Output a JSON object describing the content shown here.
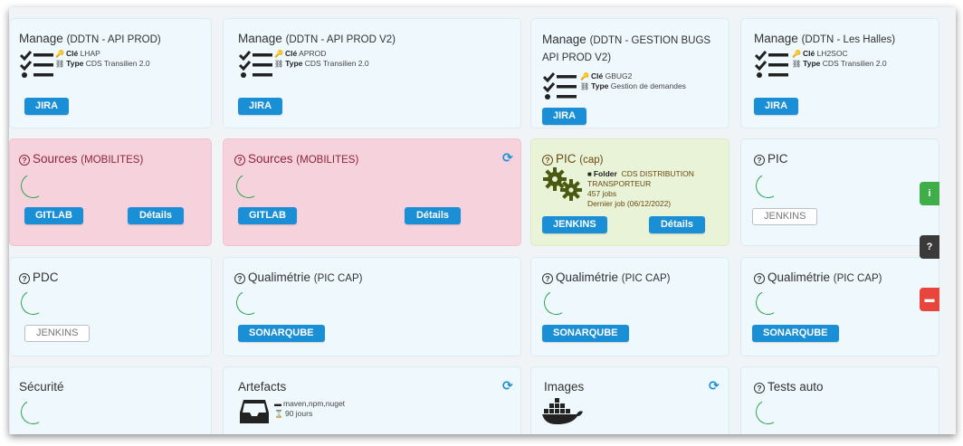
{
  "row1": [
    {
      "title": "Manage",
      "sub": "(DDTN - API PROD)",
      "key_label": "Clé",
      "key": "LHAP",
      "type_label": "Type",
      "type": "CDS Transilien 2.0",
      "button": "JIRA"
    },
    {
      "title": "Manage",
      "sub": "(DDTN - API PROD V2)",
      "key_label": "Clé",
      "key": "APROD",
      "type_label": "Type",
      "type": "CDS Transilien 2.0",
      "button": "JIRA"
    },
    {
      "title": "Manage",
      "sub": "(DDTN - GESTION BUGS API PROD V2)",
      "key_label": "Clé",
      "key": "GBUG2",
      "type_label": "Type",
      "type": "Gestion de demandes",
      "button": "JIRA"
    },
    {
      "title": "Manage",
      "sub": "(DDTN - Les Halles)",
      "key_label": "Clé",
      "key": "LH2SOC",
      "type_label": "Type",
      "type": "CDS Transilien 2.0",
      "button": "JIRA"
    }
  ],
  "row2": [
    {
      "title": "Sources",
      "sub": "(MOBILITES)",
      "button": "GITLAB",
      "details": "Détails"
    },
    {
      "title": "Sources",
      "sub": "(MOBILITES)",
      "button": "GITLAB",
      "details": "Détails"
    },
    {
      "title": "PIC",
      "sub": "(cap)",
      "folder_label": "Folder",
      "folder": "CDS DISTRIBUTION",
      "folder2": "TRANSPORTEUR",
      "jobs": "457  jobs",
      "last_job": "Dernier job (06/12/2022)",
      "button": "JENKINS",
      "details": "Détails"
    },
    {
      "title": "PIC",
      "button": "JENKINS"
    }
  ],
  "row3": [
    {
      "title": "PDC",
      "button": "JENKINS"
    },
    {
      "title": "Qualimétrie",
      "sub": "(PIC CAP)",
      "button": "SONARQUBE"
    },
    {
      "title": "Qualimétrie",
      "sub": "(PIC CAP)",
      "button": "SONARQUBE"
    },
    {
      "title": "Qualimétrie",
      "sub": "(PIC CAP)",
      "button": "SONARQUBE"
    }
  ],
  "row4": [
    {
      "title": "Sécurité"
    },
    {
      "title": "Artefacts",
      "formats": "maven,npm,nuget",
      "retention": "90 jours"
    },
    {
      "title": "Images"
    },
    {
      "title": "Tests auto"
    }
  ],
  "side_tabs": [
    {
      "icon": "info-icon",
      "color": "#3fae49"
    },
    {
      "icon": "help-icon",
      "color": "#3a3a3a"
    },
    {
      "icon": "comment-icon",
      "color": "#e8463c"
    }
  ],
  "colors": {
    "primary": "#1a8fd6",
    "spinner": "#2aa34e",
    "pink_card": "#f5d2dc",
    "green_card": "#e8f3d7",
    "blue_card": "#eef8fd"
  }
}
